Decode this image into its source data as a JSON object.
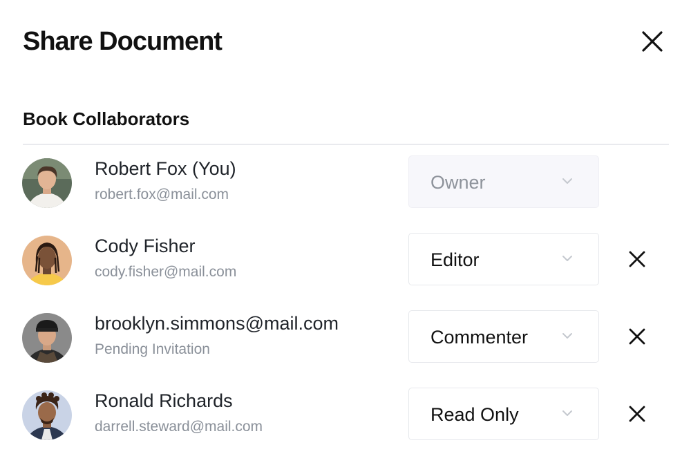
{
  "dialog": {
    "title": "Share Document",
    "close_icon": "close-icon"
  },
  "collaborators_section": {
    "title": "Book Collaborators",
    "items": [
      {
        "name": "Robert Fox (You)",
        "email": "robert.fox@mail.com",
        "role": "Owner",
        "role_disabled": true,
        "removable": false
      },
      {
        "name": "Cody Fisher",
        "email": "cody.fisher@mail.com",
        "role": "Editor",
        "role_disabled": false,
        "removable": true
      },
      {
        "name": "brooklyn.simmons@mail.com",
        "email": "Pending Invitation",
        "role": "Commenter",
        "role_disabled": false,
        "removable": true
      },
      {
        "name": "Ronald Richards",
        "email": "darrell.steward@mail.com",
        "role": "Read Only",
        "role_disabled": false,
        "removable": true
      }
    ]
  },
  "icons": {
    "dropdown": "chevron-down-icon",
    "remove": "close-icon"
  },
  "colors": {
    "text_primary": "#111111",
    "text_secondary": "#8a9099",
    "border": "#e6e8ec",
    "disabled_bg": "#f7f7fb"
  }
}
